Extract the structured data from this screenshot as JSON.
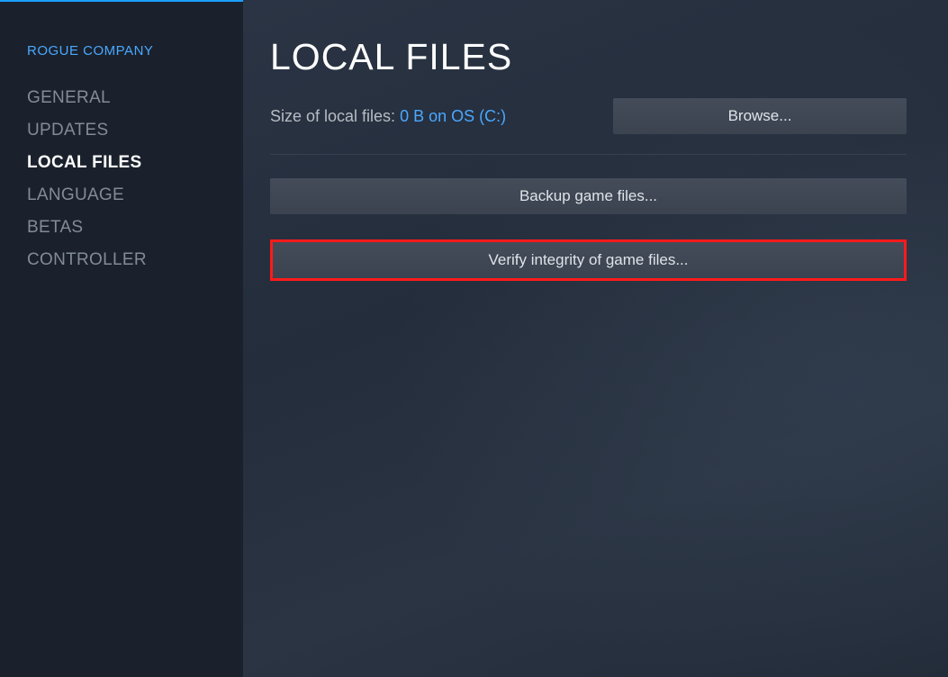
{
  "game_title": "ROGUE COMPANY",
  "sidebar": {
    "items": [
      {
        "label": "GENERAL",
        "active": false
      },
      {
        "label": "UPDATES",
        "active": false
      },
      {
        "label": "LOCAL FILES",
        "active": true
      },
      {
        "label": "LANGUAGE",
        "active": false
      },
      {
        "label": "BETAS",
        "active": false
      },
      {
        "label": "CONTROLLER",
        "active": false
      }
    ]
  },
  "main": {
    "page_title": "LOCAL FILES",
    "size_label": "Size of local files: ",
    "size_value": "0 B on OS (C:)",
    "browse_label": "Browse...",
    "backup_label": "Backup game files...",
    "verify_label": "Verify integrity of game files..."
  }
}
